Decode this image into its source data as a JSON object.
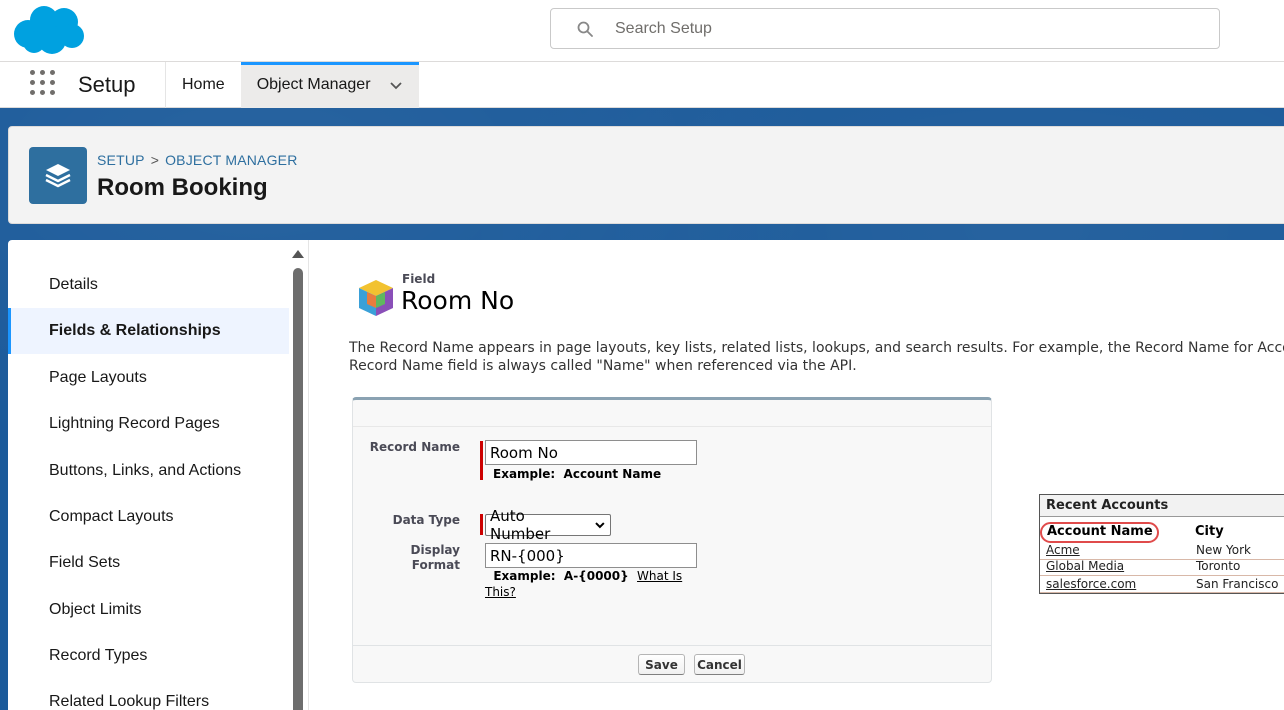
{
  "header": {
    "logo": "salesforce-cloud-logo",
    "search_placeholder": "Search Setup"
  },
  "nav": {
    "app_name": "Setup",
    "tabs": [
      {
        "label": "Home",
        "active": false
      },
      {
        "label": "Object Manager",
        "active": true
      }
    ]
  },
  "breadcrumb": {
    "root": "SETUP",
    "separator": ">",
    "current": "OBJECT MANAGER"
  },
  "object": {
    "title": "Room Booking",
    "icon": "layers-icon"
  },
  "sidebar": {
    "items": [
      {
        "label": "Details",
        "active": false
      },
      {
        "label": "Fields & Relationships",
        "active": true
      },
      {
        "label": "Page Layouts",
        "active": false
      },
      {
        "label": "Lightning Record Pages",
        "active": false
      },
      {
        "label": "Buttons, Links, and Actions",
        "active": false
      },
      {
        "label": "Compact Layouts",
        "active": false
      },
      {
        "label": "Field Sets",
        "active": false
      },
      {
        "label": "Object Limits",
        "active": false
      },
      {
        "label": "Record Types",
        "active": false
      },
      {
        "label": "Related Lookup Filters",
        "active": false
      }
    ]
  },
  "main": {
    "field_label": "Field",
    "field_name": "Room No",
    "description_line1": "The Record Name appears in page layouts, key lists, related lists, lookups, and search results. For example, the Record Name for Account is Account Name and for Case it is Case Number.",
    "description_line2": "Record Name field is always called \"Name\" when referenced via the API."
  },
  "form": {
    "record_name_label": "Record Name",
    "record_name_value": "Room No",
    "record_name_example_prefix": "Example:",
    "record_name_example": "Account Name",
    "data_type_label": "Data Type",
    "data_type_value": "Auto Number",
    "display_format_label_1": "Display",
    "display_format_label_2": "Format",
    "display_format_value": "RN-{000}",
    "display_format_example_prefix": "Example:",
    "display_format_example": "A-{0000}",
    "help_link_1": "What Is",
    "help_link_2": "This?",
    "save_label": "Save",
    "cancel_label": "Cancel"
  },
  "recent_accounts": {
    "title": "Recent Accounts",
    "columns": [
      "Account Name",
      "City"
    ],
    "rows": [
      [
        "Acme",
        "New York"
      ],
      [
        "Global Media",
        "Toronto"
      ],
      [
        "salesforce.com",
        "San Francisco"
      ]
    ],
    "highlight_color": "#e04b4b"
  },
  "colors": {
    "brand_blue": "#1b96ff",
    "band": "#1b5a9a",
    "object_icon": "#2e6f9f",
    "required": "#c00000"
  }
}
